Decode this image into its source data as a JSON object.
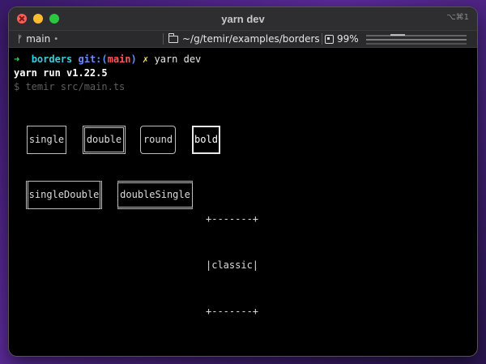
{
  "window": {
    "title": "yarn dev",
    "shortcut": "⌥⌘1"
  },
  "statusbar": {
    "branch": "main",
    "branch_dot": "•",
    "path": "~/g/temir/examples/borders",
    "cpu": "99%"
  },
  "terminal": {
    "prompt_arrow": "➜",
    "dir": "borders",
    "git_prefix": "git:(",
    "git_branch": "main",
    "git_suffix": ")",
    "dirty_mark": "✗",
    "command": "yarn dev",
    "yarn_version": "yarn run v1.22.5",
    "run_line": "$ temir src/main.ts"
  },
  "boxes": {
    "single": "single",
    "double": "double",
    "round": "round",
    "bold": "bold",
    "singleDouble": "singleDouble",
    "doubleSingle": "doubleSingle",
    "classic_top": "+-------+",
    "classic_mid": "|classic|",
    "classic_bottom": "+-------+"
  }
}
